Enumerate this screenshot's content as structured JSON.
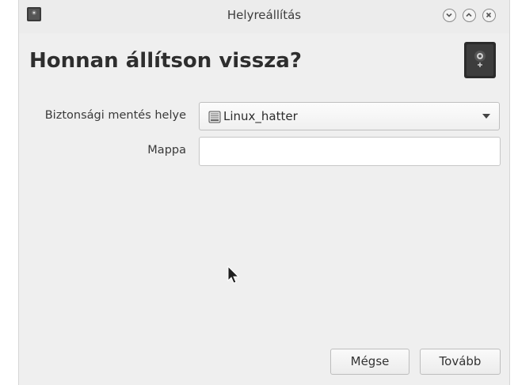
{
  "window": {
    "title": "Helyreállítás"
  },
  "heading": "Honnan állítson vissza?",
  "form": {
    "location_label": "Biztonsági mentés helye",
    "location_value": "Linux_hatter",
    "folder_label": "Mappa",
    "folder_value": ""
  },
  "buttons": {
    "cancel": "Mégse",
    "next": "Tovább"
  },
  "icons": {
    "title_icon": "safe-icon",
    "heading_icon": "safe-icon",
    "drive_icon": "drive-icon",
    "minimize": "chevron-down-icon",
    "maximize": "chevron-up-icon",
    "close": "close-icon"
  }
}
